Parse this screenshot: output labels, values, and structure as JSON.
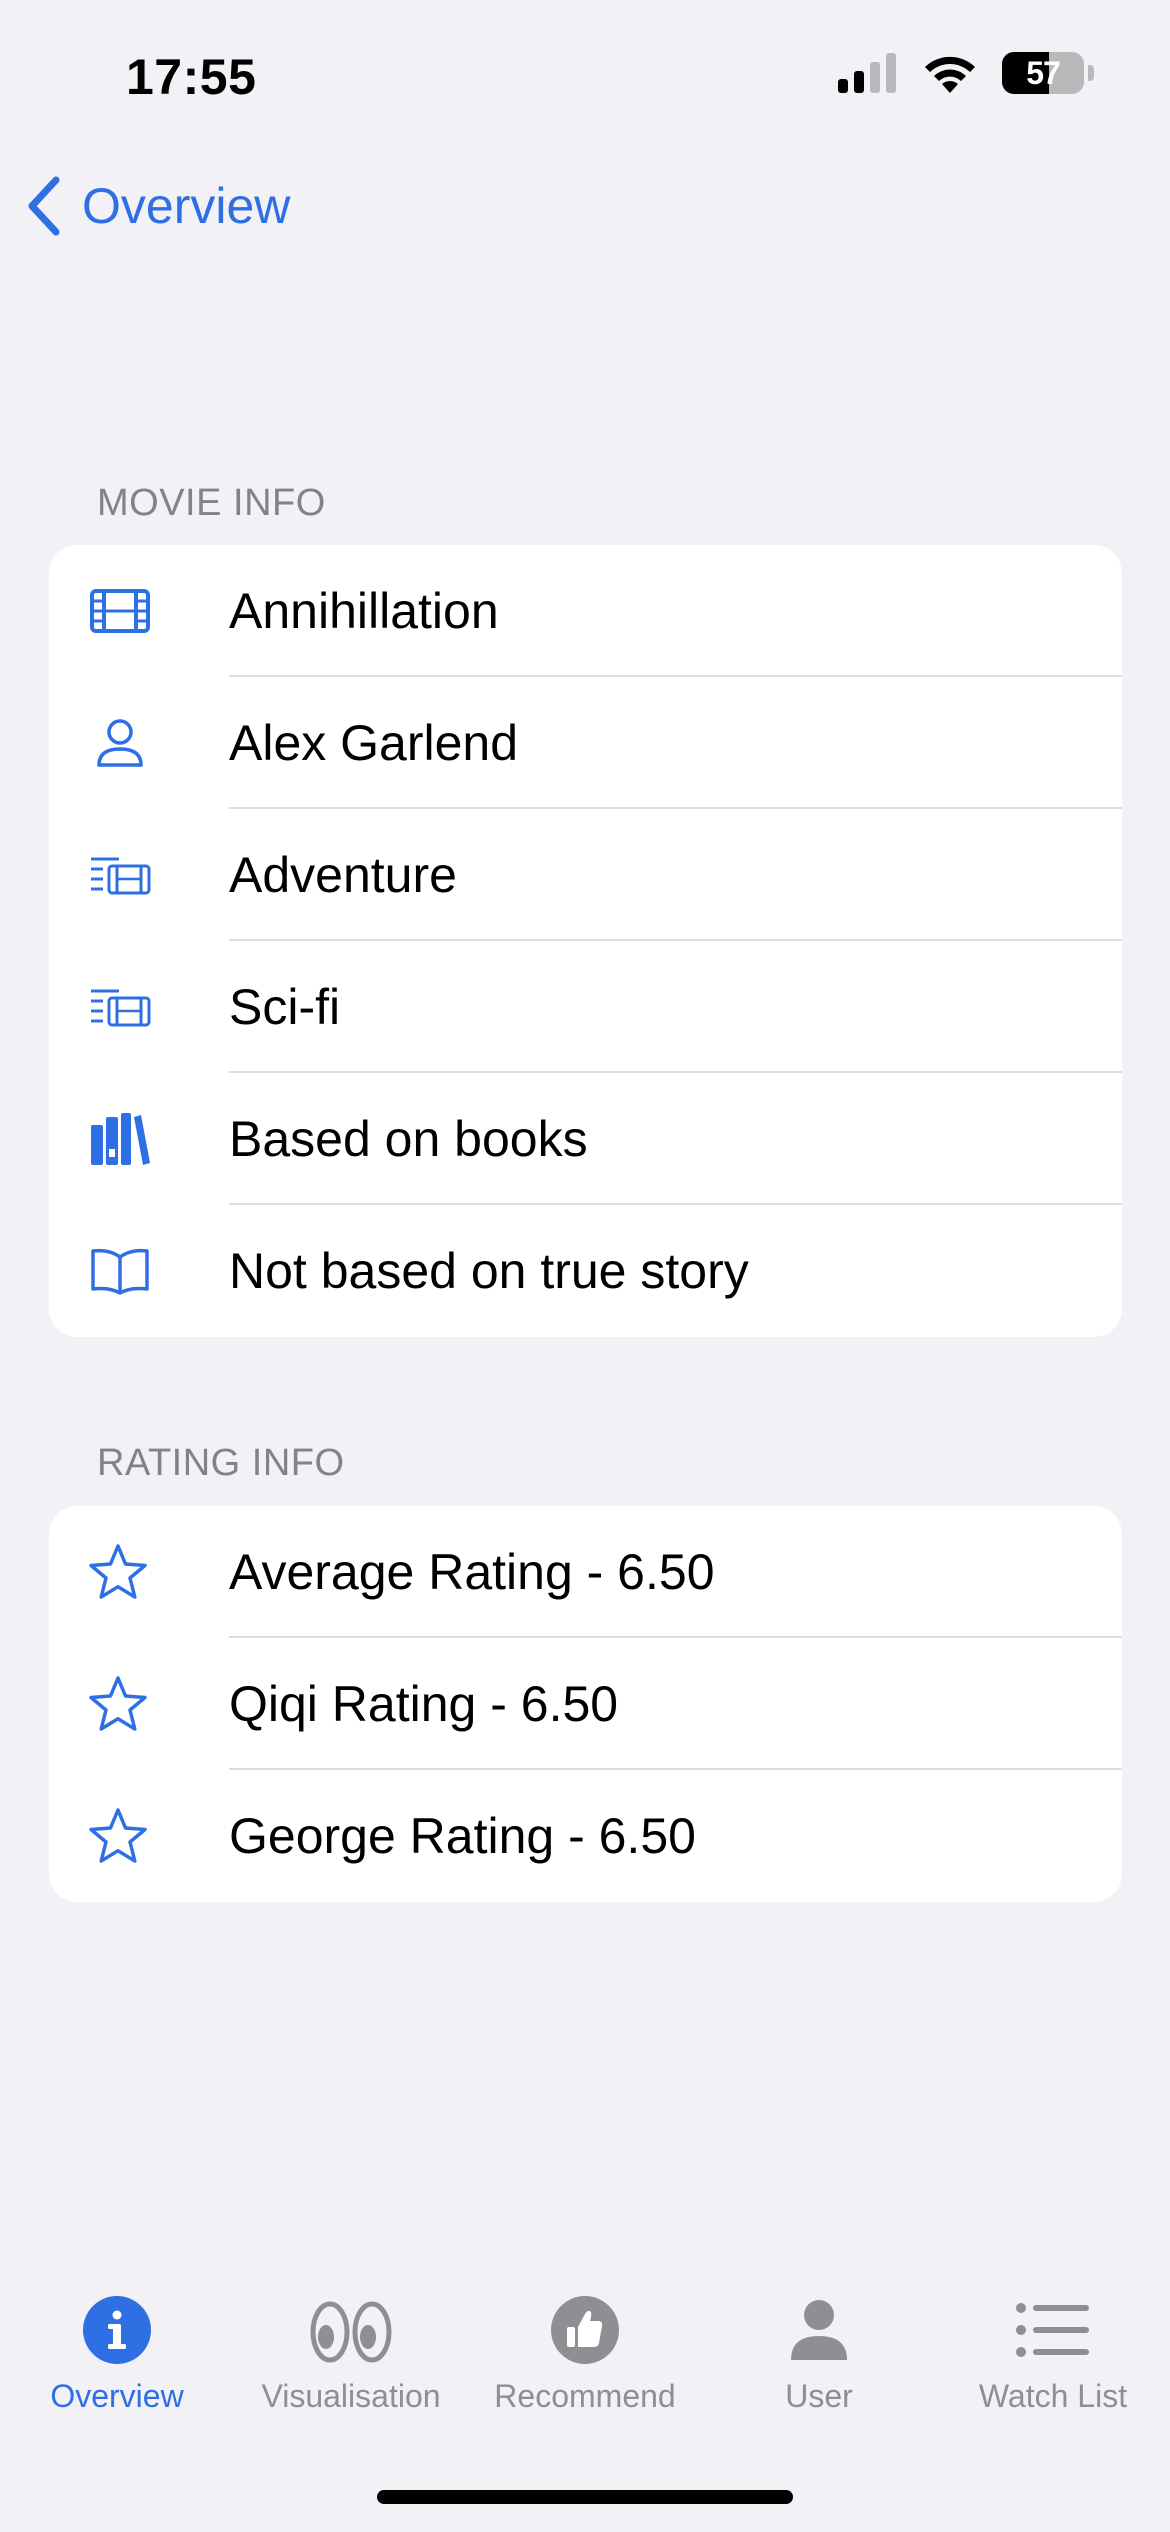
{
  "status_bar": {
    "time": "17:55",
    "battery_percent": "57"
  },
  "nav": {
    "back_label": "Overview"
  },
  "movie_info": {
    "header": "MOVIE INFO",
    "rows": [
      {
        "icon": "film-icon",
        "label": "Annihillation"
      },
      {
        "icon": "person-icon",
        "label": "Alex Garlend"
      },
      {
        "icon": "genre-icon",
        "label": "Adventure"
      },
      {
        "icon": "genre-icon",
        "label": "Sci-fi"
      },
      {
        "icon": "books-icon",
        "label": "Based on books"
      },
      {
        "icon": "book-open-icon",
        "label": "Not based on true story"
      }
    ]
  },
  "rating_info": {
    "header": "RATING INFO",
    "rows": [
      {
        "icon": "star-icon",
        "label": "Average Rating - 6.50"
      },
      {
        "icon": "star-icon",
        "label": "Qiqi Rating - 6.50"
      },
      {
        "icon": "star-icon",
        "label": "George Rating - 6.50"
      }
    ]
  },
  "tabs": [
    {
      "icon": "info-icon",
      "label": "Overview",
      "active": true
    },
    {
      "icon": "eyes-icon",
      "label": "Visualisation",
      "active": false
    },
    {
      "icon": "thumbs-up-icon",
      "label": "Recommend",
      "active": false
    },
    {
      "icon": "user-icon",
      "label": "User",
      "active": false
    },
    {
      "icon": "list-icon",
      "label": "Watch List",
      "active": false
    }
  ],
  "colors": {
    "accent": "#2f6fe4",
    "background": "#f1f1f6",
    "inactive_tab": "#8e8e93"
  }
}
